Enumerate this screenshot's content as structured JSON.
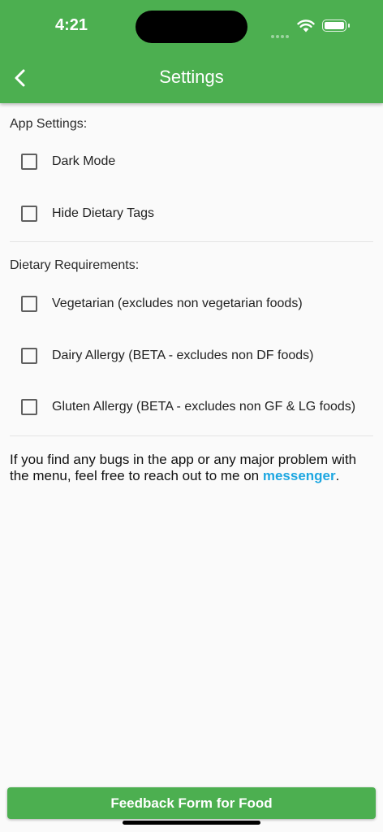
{
  "status_bar": {
    "time": "4:21"
  },
  "header": {
    "title": "Settings"
  },
  "app_settings": {
    "label": "App Settings:",
    "options": [
      {
        "label": "Dark Mode",
        "checked": false
      },
      {
        "label": "Hide Dietary Tags",
        "checked": false
      }
    ]
  },
  "dietary": {
    "label": "Dietary Requirements:",
    "options": [
      {
        "label": "Vegetarian (excludes non vegetarian foods)",
        "checked": false
      },
      {
        "label": "Dairy Allergy (BETA - excludes non DF foods)",
        "checked": false
      },
      {
        "label": "Gluten Allergy (BETA - excludes non GF & LG foods)",
        "checked": false
      }
    ]
  },
  "info": {
    "text": "If you find any bugs in the app or any major problem with the menu, feel free to reach out to me on ",
    "link": "messenger",
    "suffix": "."
  },
  "footer": {
    "button_label": "Feedback Form for Food"
  },
  "colors": {
    "accent": "#4caf50",
    "link": "#1ea7e1"
  }
}
